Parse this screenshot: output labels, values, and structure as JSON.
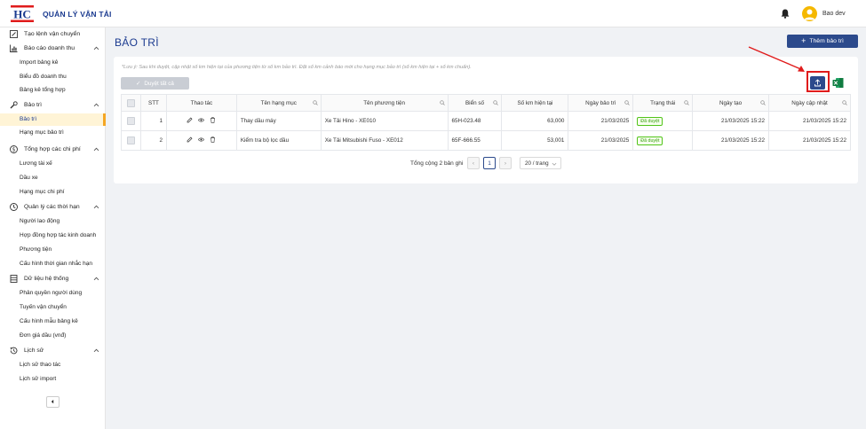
{
  "header": {
    "app_title": "QUẢN LÝ VẬN TẢI",
    "logo_text": "HC",
    "user_name": "Bao dev"
  },
  "sidebar": {
    "groups": [
      {
        "label": "Tạo lệnh vận chuyển",
        "icon": "edit-icon",
        "items": []
      },
      {
        "label": "Báo cáo doanh thu",
        "icon": "bar-chart-icon",
        "items": [
          "Import bảng kê",
          "Biểu đồ doanh thu",
          "Bảng kê tổng hợp"
        ]
      },
      {
        "label": "Bảo trì",
        "icon": "wrench-icon",
        "items": [
          "Bảo trì",
          "Hạng mục bảo trì"
        ]
      },
      {
        "label": "Tổng hợp các chi phí",
        "icon": "dollar-icon",
        "items": [
          "Lương tài xế",
          "Dầu xe",
          "Hạng mục chi phí"
        ]
      },
      {
        "label": "Quản lý các thời hạn",
        "icon": "clock-icon",
        "items": [
          "Người lao động",
          "Hợp đồng hợp tác kinh doanh",
          "Phương tiện",
          "Cấu hình thời gian nhắc hạn"
        ]
      },
      {
        "label": "Dữ liệu hệ thống",
        "icon": "database-icon",
        "items": [
          "Phân quyền người dùng",
          "Tuyến vận chuyển",
          "Cấu hình mẫu bảng kê",
          "Đơn giá dầu (vnđ)"
        ]
      },
      {
        "label": "Lịch sử",
        "icon": "history-icon",
        "items": [
          "Lịch sử thao tác",
          "Lịch sử import"
        ]
      }
    ],
    "active_item": "Bảo trì"
  },
  "main": {
    "page_title": "BẢO TRÌ",
    "add_button": "Thêm bảo trì",
    "note": "*Lưu ý: Sau khi duyệt, cập nhật số km hiện tại của phương tiện từ số km bảo trì. Đặt số km cảnh báo mới cho hạng mục bảo trì (số km hiện tại + số km chuẩn).",
    "approve_all": "Duyệt tất cả",
    "columns": [
      "STT",
      "Thao tác",
      "Tên hạng mục",
      "Tên phương tiện",
      "Biển số",
      "Số km hiện tại",
      "Ngày bảo trì",
      "Trạng thái",
      "Ngày tạo",
      "Ngày cập nhật"
    ],
    "rows": [
      {
        "stt": "1",
        "item": "Thay dầu máy",
        "vehicle": "Xe Tải Hino - XE010",
        "plate": "65H-023.48",
        "km": "63,000",
        "date": "21/03/2025",
        "status": "Đã duyệt",
        "created": "21/03/2025 15:22",
        "updated": "21/03/2025 15:22"
      },
      {
        "stt": "2",
        "item": "Kiểm tra bộ lọc dầu",
        "vehicle": "Xe Tải Mitsubishi Fuso - XE012",
        "plate": "65F-666.55",
        "km": "53,001",
        "date": "21/03/2025",
        "status": "Đã duyệt",
        "created": "21/03/2025 15:22",
        "updated": "21/03/2025 15:22"
      }
    ],
    "pagination": {
      "total": "Tổng cộng 2 bản ghi",
      "current_page": "1",
      "page_size": "20 / trang"
    }
  },
  "colors": {
    "primary": "#2c4a8c",
    "accent": "#f5a623",
    "highlight": "#e01b1b",
    "success": "#52c41a"
  }
}
